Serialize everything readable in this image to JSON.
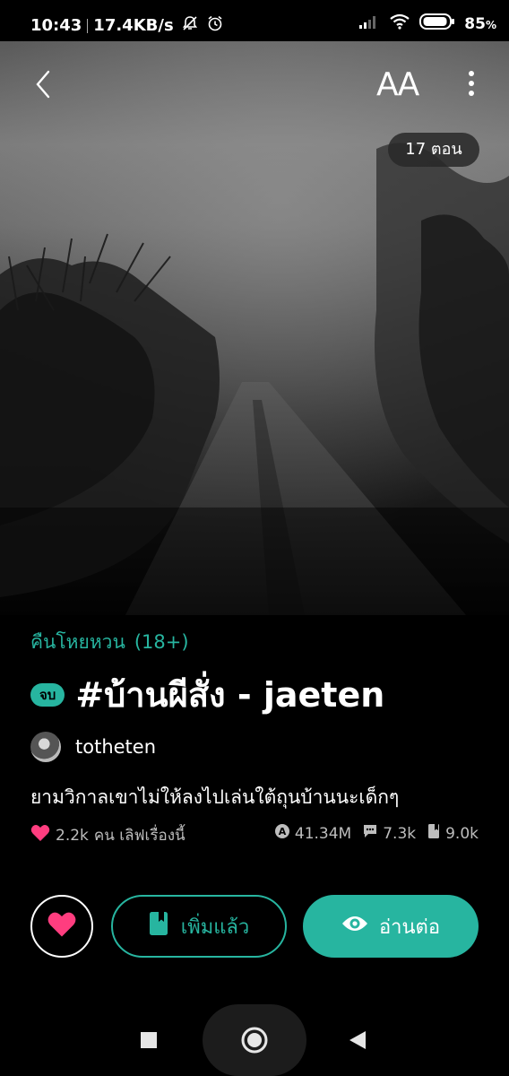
{
  "status_bar": {
    "time": "10:43",
    "network_speed": "17.4KB/s",
    "battery_level": "85",
    "battery_unit": "%",
    "icons": [
      "mute-icon",
      "alarm-icon",
      "signal-icon",
      "wifi-icon",
      "battery-icon"
    ]
  },
  "top_bar": {
    "back_icon": "chevron-left-icon",
    "font_size_label": "AA",
    "more_icon": "vertical-dots-icon"
  },
  "cover": {
    "episodes_label": "17 ตอน"
  },
  "story": {
    "category": "คืนโหยหวน",
    "age_rating": "(18+)",
    "status_badge": "จบ",
    "title": "#บ้านผีสั่ง - jaeten",
    "author": "totheten",
    "description": "ยามวิกาลเขาไม่ให้ลงไปเล่นใต้ถุนบ้านนะเด็กๆ",
    "likes_count": "2.2k",
    "likes_text": "คน เลิฟเรื่องนี้",
    "views": "41.34M",
    "comments": "7.3k",
    "bookmarks": "9.0k"
  },
  "actions": {
    "love_icon": "heart-icon",
    "added_label": "เพิ่มแล้ว",
    "read_label": "อ่านต่อ"
  },
  "nav_bar": {
    "icons": [
      "square-recents-icon",
      "circle-home-icon",
      "triangle-back-icon"
    ]
  },
  "colors": {
    "accent": "#27b5a0",
    "heart": "#ff3d7f",
    "background": "#000000"
  }
}
